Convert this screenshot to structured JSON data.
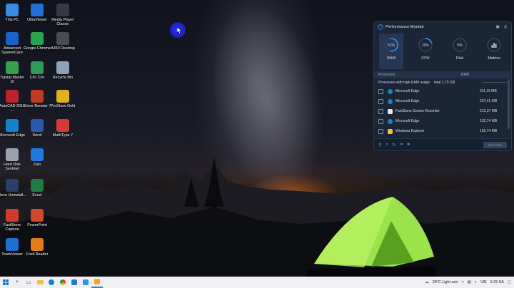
{
  "desktop": {
    "icons": [
      {
        "label": "This PC",
        "icon": "computer-icon",
        "color": "#3a8be0"
      },
      {
        "label": "UltraViewer",
        "icon": "ultraviewer-icon",
        "color": "#1f6fd6"
      },
      {
        "label": "Media Player Classic",
        "icon": "media-player-icon",
        "color": "#333a44"
      },
      {
        "label": "Advanced SystemCare",
        "icon": "systemcare-icon",
        "color": "#1a62c8"
      },
      {
        "label": "Google Chrome",
        "icon": "chrome-icon",
        "color": "#2aa44c"
      },
      {
        "label": "A360 Desktop",
        "icon": "a360-icon",
        "color": "#4b4b52"
      },
      {
        "label": "Typing Master 10",
        "icon": "typing-master-icon",
        "color": "#36a14a"
      },
      {
        "label": "Cốc Cốc",
        "icon": "coccoc-icon",
        "color": "#2a9b58"
      },
      {
        "label": "Recycle Bin",
        "icon": "recycle-bin-icon",
        "color": "#8aa3b8"
      },
      {
        "label": "AutoCAD 2016 -...",
        "icon": "autocad-icon",
        "color": "#b8262c"
      },
      {
        "label": "Driver Booster 7",
        "icon": "driver-booster-icon",
        "color": "#c33a22"
      },
      {
        "label": "ProShow Gold",
        "icon": "proshow-icon",
        "color": "#e0b020"
      },
      {
        "label": "Microsoft Edge",
        "icon": "edge-icon",
        "color": "#1583c9"
      },
      {
        "label": "Word",
        "icon": "word-icon",
        "color": "#2a5ba8"
      },
      {
        "label": "MathType 7",
        "icon": "mathtype-icon",
        "color": "#d43a3a"
      },
      {
        "label": "Hard Disk Sentinel",
        "icon": "hdsentinel-icon",
        "color": "#9aa2ad"
      },
      {
        "label": "Zalo",
        "icon": "zalo-icon",
        "color": "#1f7ae0"
      },
      {
        "label": "Revo Uninstall...",
        "icon": "revo-icon",
        "color": "#2a3f6a"
      },
      {
        "label": "Excel",
        "icon": "excel-icon",
        "color": "#1f7a44"
      },
      {
        "label": "FastStone Capture",
        "icon": "faststone-capture-icon",
        "color": "#d23a2a"
      },
      {
        "label": "PowerPoint",
        "icon": "powerpoint-icon",
        "color": "#d2482a"
      },
      {
        "label": "TeamViewer",
        "icon": "teamviewer-icon",
        "color": "#1d6fd1"
      },
      {
        "label": "Foxit Reader",
        "icon": "foxit-icon",
        "color": "#e27b1b"
      }
    ]
  },
  "perf_monitor": {
    "title": "Performance Monitor",
    "metrics": [
      {
        "label": "RAM",
        "value": "51%",
        "fraction": 0.51,
        "active": true
      },
      {
        "label": "CPU",
        "value": "20%",
        "fraction": 0.2,
        "active": false
      },
      {
        "label": "Disk",
        "value": "0%",
        "fraction": 0.0,
        "active": false
      },
      {
        "label": "Metrics",
        "value": "",
        "fraction": 0,
        "active": false
      }
    ],
    "table": {
      "col_processes": "Processes",
      "col_ram": "RAM",
      "subheader": "Processes with high RAM usage",
      "total": "total 1,70 GB",
      "rows": [
        {
          "name": "Microsoft Edge",
          "ram": "311,16 MB",
          "icon": "edge-icon"
        },
        {
          "name": "Microsoft Edge",
          "ram": "237,41 MB",
          "icon": "edge-icon"
        },
        {
          "name": "FastStone Screen Recorder",
          "ram": "213,37 MB",
          "icon": "faststone-recorder-icon"
        },
        {
          "name": "Microsoft Edge",
          "ram": "192,74 MB",
          "icon": "edge-icon"
        },
        {
          "name": "Windows Explorer",
          "ram": "165,74 MB",
          "icon": "folder-icon"
        }
      ]
    },
    "end_task_label": "End Task"
  },
  "taskbar": {
    "weather": "28°C  Light rain",
    "language": "VIE",
    "time": "9:25 SA"
  },
  "colors": {
    "accent": "#3a7de0",
    "panel_bg": "#1a2536",
    "taskbar_bg": "#f0f0f4"
  }
}
